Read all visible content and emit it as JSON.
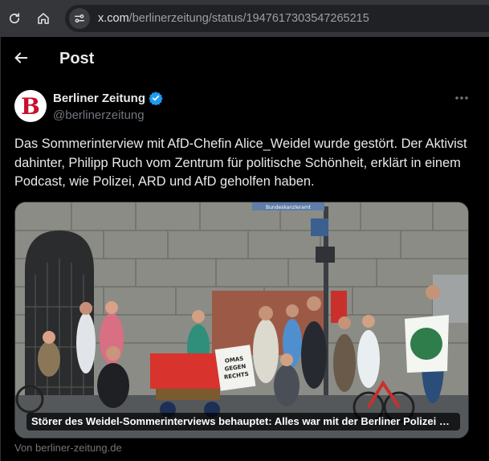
{
  "browser": {
    "url_domain": "x.com",
    "url_path": "/berlinerzeitung/status/1947617303547265215",
    "icons": [
      "reload-icon",
      "home-icon",
      "site-settings-icon"
    ]
  },
  "header": {
    "title": "Post",
    "back_icon": "arrow-left-icon"
  },
  "author": {
    "name": "Berliner Zeitung",
    "handle": "@berlinerzeitung",
    "verified": true,
    "verified_color": "#1d9bf0",
    "avatar_letter": "B"
  },
  "post": {
    "text": "Das Sommerinterview mit AfD-Chefin Alice_Weidel wurde gestört. Der Aktivist dahinter, Philipp Ruch vom Zentrum für politische Schönheit, erklärt in einem Podcast, wie Polizei, ARD und AfD geholfen haben."
  },
  "media": {
    "caption": "Störer des Weidel-Sommerinterviews behauptet: Alles war mit der Berliner Polizei abg…",
    "sign_text_line1": "OMAS",
    "sign_text_line2": "GEGEN",
    "sign_text_line3": "RECHTS",
    "street_sign": "Bundeskanzleramt"
  },
  "source": {
    "text": "Von berliner-zeitung.de"
  },
  "colors": {
    "background": "#000000",
    "text_primary": "#e7e9ea",
    "text_secondary": "#71767b",
    "accent": "#1d9bf0"
  }
}
